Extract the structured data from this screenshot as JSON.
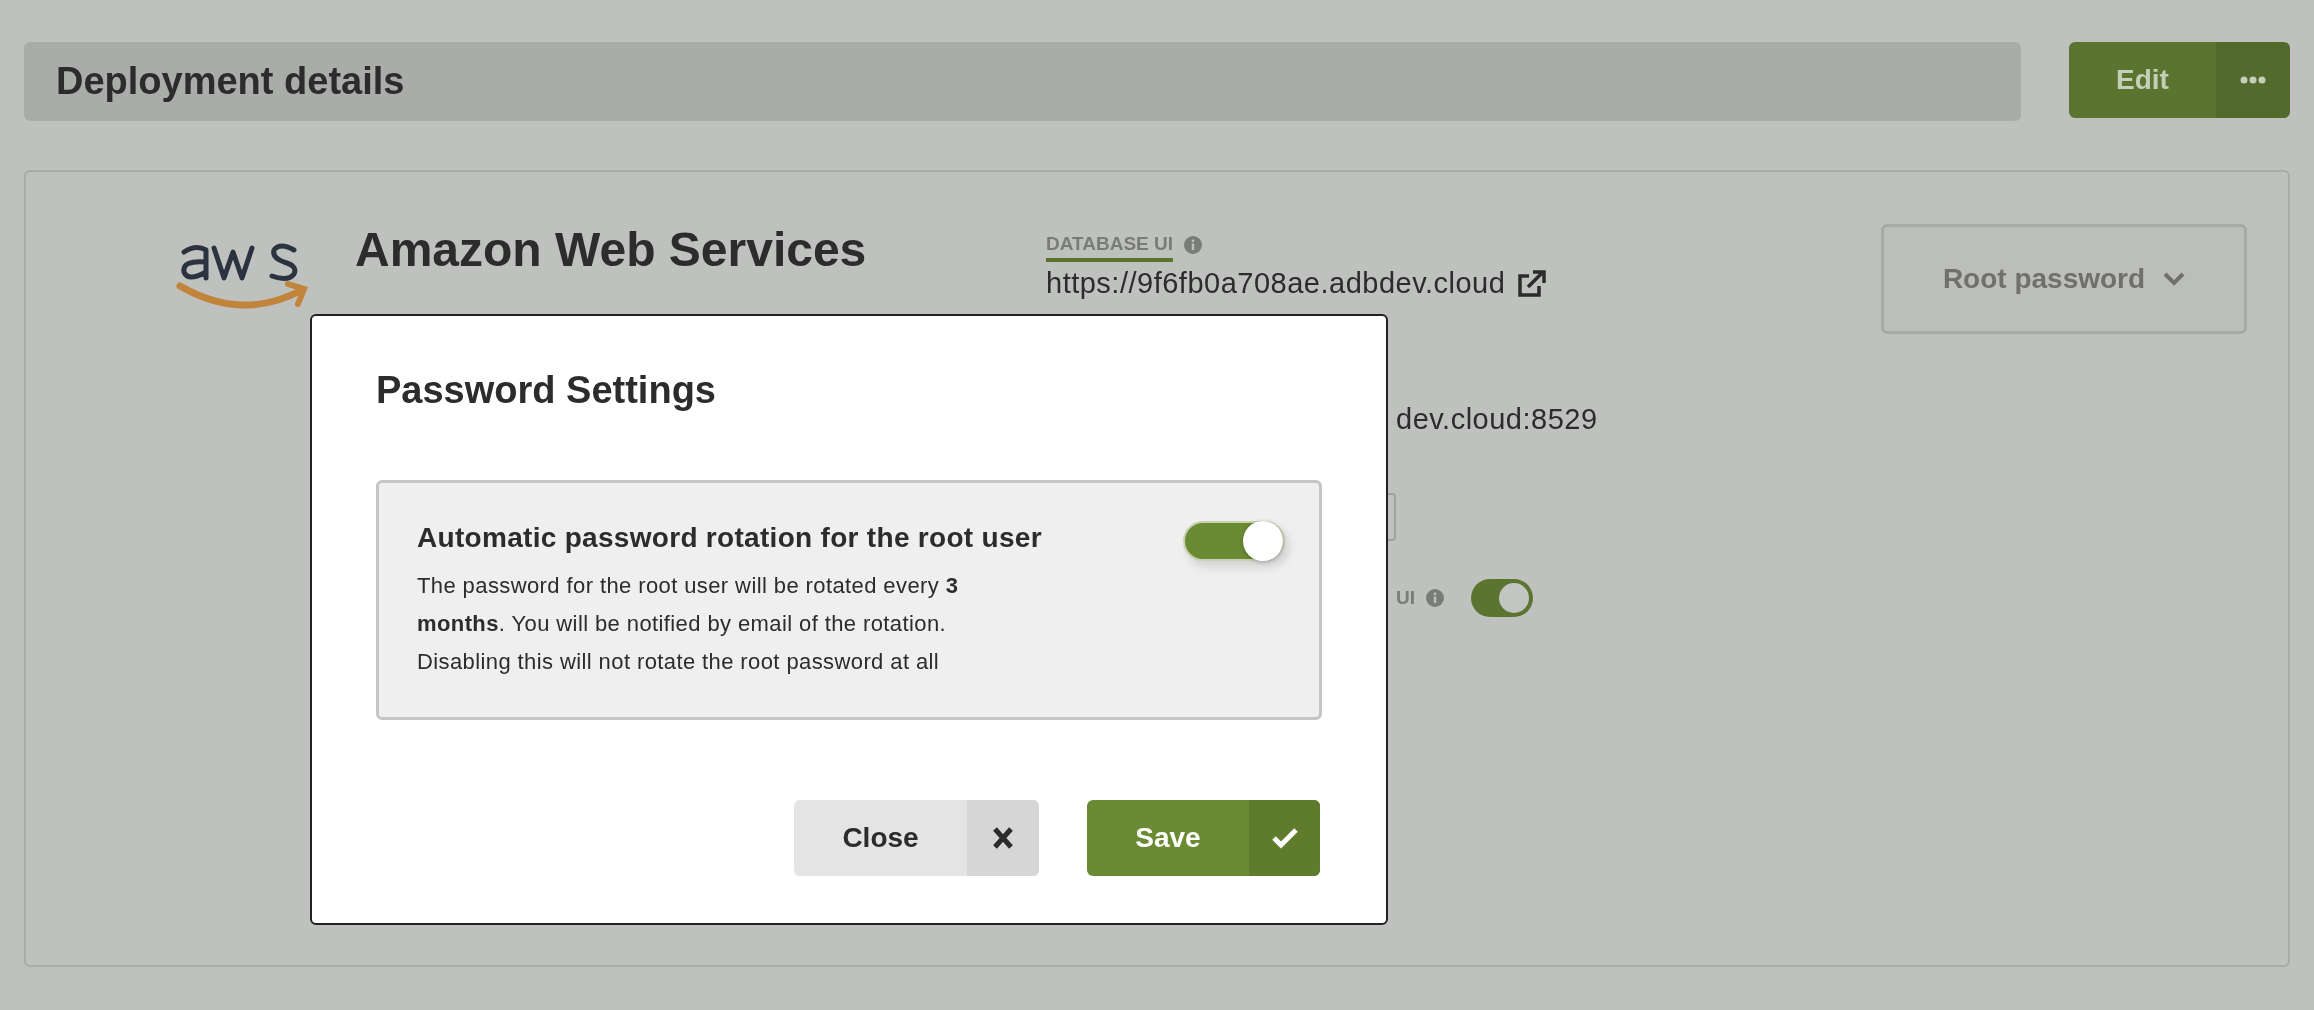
{
  "header": {
    "title": "Deployment details",
    "edit_button": "Edit"
  },
  "provider": {
    "name": "Amazon Web Services"
  },
  "database_ui": {
    "label": "DATABASE UI",
    "url": "https://9f6fb0a708ae.adbdev.cloud"
  },
  "endpoint_fragment": "dev.cloud:8529",
  "ui_toggle": {
    "label": "UI",
    "on": true
  },
  "root_password_button": "Root password",
  "modal": {
    "title": "Password Settings",
    "setting": {
      "title": "Automatic password rotation for the root user",
      "description": "The password for the root user will be rotated every **3 months**. You will be notified by email of the rotation. Disabling this will not rotate the root password at all",
      "on": true
    },
    "buttons": [
      {
        "label": "Close",
        "kind": "secondary"
      },
      {
        "label": "Save",
        "kind": "primary"
      }
    ]
  }
}
